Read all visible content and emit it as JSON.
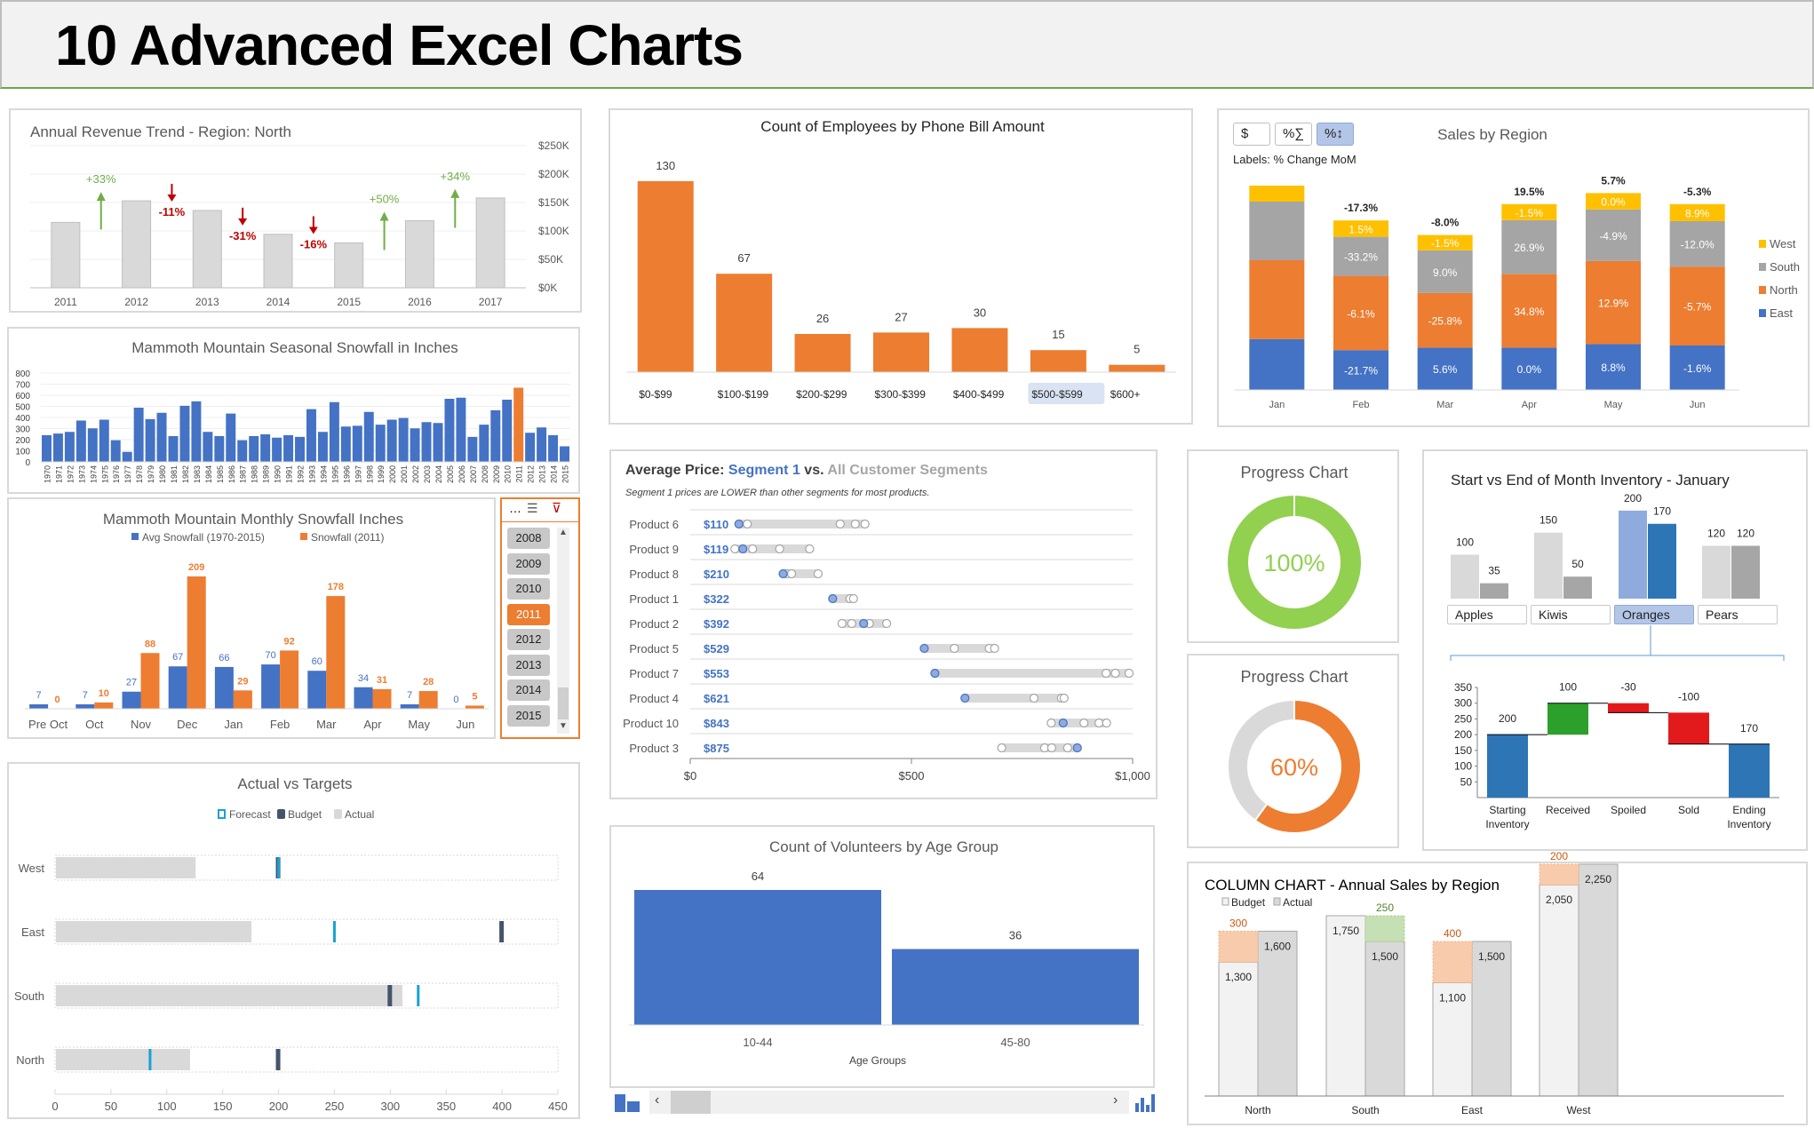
{
  "header": {
    "title": "10 Advanced Excel Charts"
  },
  "chart_data": [
    {
      "id": "revenue",
      "type": "bar",
      "title": "Annual Revenue Trend - Region: North",
      "categories": [
        "2011",
        "2012",
        "2013",
        "2014",
        "2015",
        "2016",
        "2017"
      ],
      "values": [
        115,
        153,
        136,
        94,
        79,
        118,
        158
      ],
      "units": "$K",
      "ylim": [
        0,
        250
      ],
      "yticks": [
        "$0K",
        "$50K",
        "$100K",
        "$150K",
        "$200K",
        "$250K"
      ],
      "changes": [
        {
          "label": "+33%",
          "dir": "up"
        },
        {
          "label": "-11%",
          "dir": "down"
        },
        {
          "label": "-31%",
          "dir": "down"
        },
        {
          "label": "-16%",
          "dir": "down"
        },
        {
          "label": "+50%",
          "dir": "up"
        },
        {
          "label": "+34%",
          "dir": "up"
        }
      ],
      "colors": {
        "bar": "#d9d9d9",
        "up": "#70ad47",
        "down": "#c00000"
      }
    },
    {
      "id": "seasonal",
      "type": "bar",
      "title": "Mammoth Mountain Seasonal Snowfall in Inches",
      "categories": [
        "1970",
        "1971",
        "1972",
        "1973",
        "1974",
        "1975",
        "1976",
        "1977",
        "1978",
        "1979",
        "1980",
        "1981",
        "1982",
        "1983",
        "1984",
        "1985",
        "1986",
        "1987",
        "1988",
        "1989",
        "1990",
        "1991",
        "1992",
        "1993",
        "1994",
        "1995",
        "1996",
        "1997",
        "1998",
        "1999",
        "2000",
        "2001",
        "2002",
        "2003",
        "2004",
        "2005",
        "2006",
        "2007",
        "2008",
        "2009",
        "2010",
        "2011",
        "2012",
        "2013",
        "2014",
        "2015"
      ],
      "values": [
        240,
        255,
        270,
        372,
        302,
        380,
        195,
        90,
        488,
        385,
        442,
        232,
        505,
        545,
        270,
        232,
        435,
        195,
        232,
        248,
        218,
        240,
        225,
        475,
        270,
        538,
        318,
        325,
        450,
        335,
        380,
        395,
        302,
        358,
        350,
        568,
        578,
        225,
        335,
        465,
        560,
        668,
        262,
        310,
        240,
        140
      ],
      "highlight": "2011",
      "ylim": [
        0,
        800
      ],
      "yticks": [
        "0",
        "100",
        "200",
        "300",
        "400",
        "500",
        "600",
        "700",
        "800"
      ],
      "colors": {
        "bar": "#4472c4",
        "highlight": "#ed7d31"
      }
    },
    {
      "id": "monthly",
      "type": "bar",
      "title": "Mammoth Mountain Monthly Snowfall Inches",
      "categories": [
        "Pre Oct",
        "Oct",
        "Nov",
        "Dec",
        "Jan",
        "Feb",
        "Mar",
        "Apr",
        "May",
        "Jun"
      ],
      "series": [
        {
          "name": "Avg Snowfall (1970-2015)",
          "values": [
            7,
            7,
            27,
            67,
            66,
            70,
            60,
            34,
            7,
            0
          ],
          "color": "#4472c4"
        },
        {
          "name": "Snowfall (2011)",
          "values": [
            0,
            10,
            88,
            209,
            29,
            92,
            178,
            31,
            28,
            5
          ],
          "color": "#ed7d31"
        }
      ],
      "ylim": [
        0,
        230
      ],
      "legend": "top"
    },
    {
      "id": "targets",
      "type": "bar",
      "title": "Actual vs Targets",
      "categories": [
        "West",
        "East",
        "South",
        "North"
      ],
      "series": [
        {
          "name": "Forecast",
          "values": [
            200,
            250,
            325,
            85
          ],
          "color": "#17a2d2"
        },
        {
          "name": "Budget",
          "values": [
            200,
            400,
            300,
            200
          ],
          "color": "#44546a"
        },
        {
          "name": "Actual",
          "values": [
            125,
            175,
            310,
            120
          ],
          "color": "#d9d9d9"
        }
      ],
      "xlim": [
        0,
        450
      ],
      "xticks": [
        "0",
        "50",
        "100",
        "150",
        "200",
        "250",
        "300",
        "350",
        "400",
        "450"
      ],
      "legend": "top"
    },
    {
      "id": "phonebill",
      "type": "bar",
      "title": "Count of Employees by Phone Bill Amount",
      "categories": [
        "$0-$99",
        "$100-$199",
        "$200-$299",
        "$300-$399",
        "$400-$499",
        "$500-$599",
        "$600+"
      ],
      "values": [
        130,
        67,
        26,
        27,
        30,
        15,
        5
      ],
      "highlight_category": "$500-$599",
      "ylim": [
        0,
        140
      ],
      "colors": {
        "bar": "#ed7d31"
      }
    },
    {
      "id": "salesregion",
      "type": "bar",
      "stacked": true,
      "title": "Sales by Region",
      "subtitle": "Labels: % Change MoM",
      "categories": [
        "Jan",
        "Feb",
        "Mar",
        "Apr",
        "May",
        "Jun"
      ],
      "series": [
        {
          "name": "East",
          "color": "#4472c4",
          "values": [
            143,
            112,
            119,
            119,
            129,
            125
          ],
          "labels": [
            "",
            "-21.7%",
            "5.6%",
            "0.0%",
            "8.8%",
            "-1.6%"
          ]
        },
        {
          "name": "North",
          "color": "#ed7d31",
          "values": [
            222,
            209,
            154,
            207,
            234,
            222
          ],
          "labels": [
            "",
            "-6.1%",
            "-25.8%",
            "34.8%",
            "12.9%",
            "-5.7%"
          ]
        },
        {
          "name": "South",
          "color": "#a5a5a5",
          "values": [
            165,
            110,
            120,
            152,
            145,
            128
          ],
          "labels": [
            "",
            "-33.2%",
            "9.0%",
            "26.9%",
            "-4.9%",
            "-12.0%"
          ]
        },
        {
          "name": "West",
          "color": "#ffc000",
          "values": [
            45,
            46,
            43,
            45,
            46,
            48
          ],
          "labels": [
            "",
            "1.5%",
            "-1.5%",
            "-1.5%",
            "0.0%",
            "8.9%"
          ]
        }
      ],
      "totals_labels": [
        "",
        "-17.3%",
        "-8.0%",
        "19.5%",
        "5.7%",
        "-5.3%"
      ],
      "legend": "right",
      "buttons": [
        {
          "label": "$",
          "active": false
        },
        {
          "label": "%∑",
          "active": false
        },
        {
          "label": "%↕",
          "active": true
        }
      ]
    },
    {
      "id": "dotplot",
      "type": "scatter",
      "title_parts": [
        "Average Price: ",
        "Segment 1",
        " vs. ",
        "All Customer Segments"
      ],
      "subtitle": "Segment 1 prices are LOWER than other segments for most products.",
      "xlim": [
        0,
        1000
      ],
      "xticks": [
        "$0",
        "$500",
        "$1,000"
      ],
      "rows": [
        {
          "product": "Product 6",
          "price_label": "$110",
          "segment1": 110,
          "others": [
            129,
            339,
            373,
            395
          ]
        },
        {
          "product": "Product 9",
          "price_label": "$119",
          "segment1": 119,
          "others": [
            101,
            141,
            202,
            270
          ]
        },
        {
          "product": "Product 8",
          "price_label": "$210",
          "segment1": 210,
          "others": [
            218,
            229,
            289
          ]
        },
        {
          "product": "Product 1",
          "price_label": "$322",
          "segment1": 322,
          "others": [
            361,
            369
          ]
        },
        {
          "product": "Product 2",
          "price_label": "$392",
          "segment1": 392,
          "others": [
            343,
            365,
            405,
            444
          ]
        },
        {
          "product": "Product 5",
          "price_label": "$529",
          "segment1": 529,
          "others": [
            597,
            676,
            688
          ]
        },
        {
          "product": "Product 7",
          "price_label": "$553",
          "segment1": 553,
          "others": [
            940,
            961,
            992
          ]
        },
        {
          "product": "Product 4",
          "price_label": "$621",
          "segment1": 621,
          "others": [
            777,
            839,
            845
          ]
        },
        {
          "product": "Product 10",
          "price_label": "$843",
          "segment1": 843,
          "others": [
            816,
            890,
            924,
            941
          ]
        },
        {
          "product": "Product 3",
          "price_label": "$875",
          "segment1": 875,
          "others": [
            704,
            801,
            817,
            853
          ]
        }
      ],
      "colors": {
        "segment1": "#4472c4",
        "others": "#a6a6a6",
        "range": "#d9d9d9"
      }
    },
    {
      "id": "volunteers",
      "type": "bar",
      "title": "Count of Volunteers by Age Group",
      "xlabel": "Age Groups",
      "categories": [
        "10-44",
        "45-80"
      ],
      "values": [
        64,
        36
      ],
      "ylim": [
        0,
        72
      ],
      "colors": {
        "bar": "#4472c4"
      }
    },
    {
      "id": "progress1",
      "type": "pie",
      "title": "Progress Chart",
      "value": 100,
      "label": "100%",
      "colors": {
        "fill": "#92d050",
        "rest": "#d9d9d9"
      }
    },
    {
      "id": "progress2",
      "type": "pie",
      "title": "Progress Chart",
      "value": 60,
      "label": "60%",
      "colors": {
        "fill": "#ed7d31",
        "rest": "#d9d9d9"
      }
    },
    {
      "id": "inventory",
      "type": "bar",
      "title": "Start vs End of Month Inventory - January",
      "categories": [
        "Apples",
        "Kiwis",
        "Oranges",
        "Pears"
      ],
      "series": [
        {
          "name": "Start",
          "values": [
            100,
            150,
            200,
            120
          ]
        },
        {
          "name": "End",
          "values": [
            35,
            50,
            170,
            120
          ]
        }
      ],
      "selected": "Oranges",
      "waterfall": {
        "categories": [
          "Starting Inventory",
          "Received",
          "Spoiled",
          "Sold",
          "Ending Inventory"
        ],
        "values": [
          200,
          100,
          -30,
          -100,
          170
        ],
        "labels": [
          "200",
          "100",
          "-30",
          "-100",
          "170"
        ],
        "ylim": [
          0,
          350
        ],
        "yticks": [
          "50",
          "100",
          "150",
          "200",
          "250",
          "300",
          "350"
        ],
        "colors": {
          "total": "#2e75b6",
          "up": "#2ca02c",
          "down": "#e31a1c"
        }
      }
    },
    {
      "id": "columnchart",
      "type": "bar",
      "title": "COLUMN CHART - Annual Sales by Region",
      "categories": [
        "North",
        "South",
        "East",
        "West"
      ],
      "series": [
        {
          "name": "Budget",
          "values": [
            1300,
            1750,
            1100,
            2050
          ],
          "labels": [
            "1,300",
            "1,750",
            "1,100",
            "2,050"
          ]
        },
        {
          "name": "Actual",
          "values": [
            1600,
            1500,
            1500,
            2250
          ],
          "labels": [
            "1,600",
            "1,500",
            "1,500",
            "2,250"
          ]
        }
      ],
      "variance": [
        {
          "value": 300,
          "label": "300",
          "positive": true
        },
        {
          "value": 250,
          "label": "250",
          "positive": false
        },
        {
          "value": 400,
          "label": "400",
          "positive": true
        },
        {
          "value": 200,
          "label": "200",
          "positive": true
        }
      ],
      "ylim": [
        0,
        2500
      ],
      "legend": "top-left"
    }
  ],
  "slicer": {
    "items": [
      "2008",
      "2009",
      "2010",
      "2011",
      "2012",
      "2013",
      "2014",
      "2015"
    ],
    "selected": "2011"
  }
}
